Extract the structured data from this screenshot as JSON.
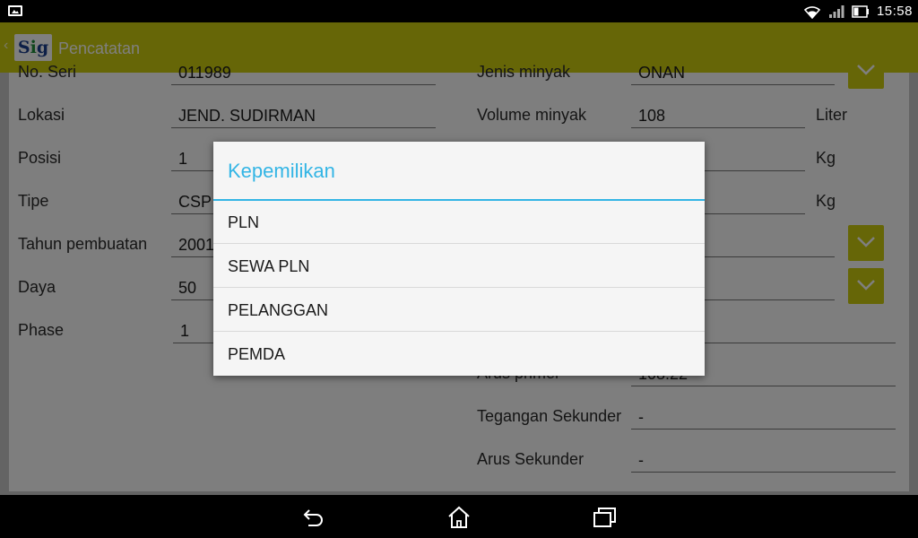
{
  "status_bar": {
    "time": "15:58",
    "icons": [
      "gallery-icon",
      "wifi-icon",
      "signal-icon",
      "battery-icon"
    ]
  },
  "action_bar": {
    "title": "Pencatatan",
    "logo_text": "Sig"
  },
  "form": {
    "left": [
      {
        "label": "No. Seri",
        "value": "011989"
      },
      {
        "label": "Lokasi",
        "value": "JEND. SUDIRMAN"
      },
      {
        "label": "Posisi",
        "value": "1"
      },
      {
        "label": "Tipe",
        "value": "CSP"
      },
      {
        "label": "Tahun pembuatan",
        "value": "2001"
      },
      {
        "label": "Daya",
        "value": "50"
      },
      {
        "label": "Phase",
        "value": "1"
      }
    ],
    "right": [
      {
        "label": "Jenis minyak",
        "value": "ONAN"
      },
      {
        "label": "Volume minyak",
        "value": "108",
        "unit": "Liter"
      },
      {
        "unit": "Kg"
      },
      {
        "unit": "Kg"
      },
      {
        "label": "Arus primer",
        "value": "108.22"
      },
      {
        "label": "Tegangan Sekunder",
        "value": "-"
      },
      {
        "label": "Arus Sekunder",
        "value": "-"
      }
    ]
  },
  "dialog": {
    "title": "Kepemilikan",
    "options": [
      "PLN",
      "SEWA PLN",
      "PELANGGAN",
      "PEMDA"
    ]
  },
  "colors": {
    "accent": "#CDCD0E",
    "dialog_title": "#33B5E5",
    "dim": "rgba(0,0,0,0.5)"
  },
  "navigation": {
    "icons": [
      "back-icon",
      "home-icon",
      "recent-apps-icon"
    ]
  }
}
